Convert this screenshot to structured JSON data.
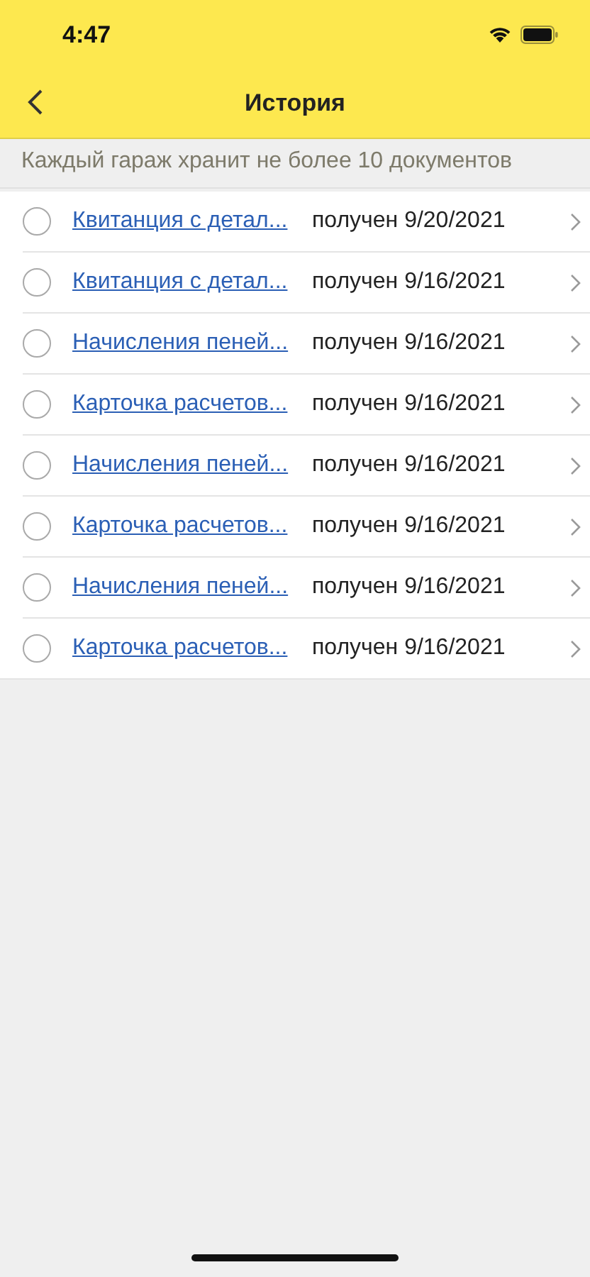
{
  "status_bar": {
    "time": "4:47"
  },
  "nav_bar": {
    "title": "История"
  },
  "notice": "Каждый гараж хранит не более 10 документов",
  "documents": [
    {
      "title": "Квитанция с детал...",
      "received": "получен 9/20/2021",
      "selected": false
    },
    {
      "title": "Квитанция с детал...",
      "received": "получен 9/16/2021",
      "selected": false
    },
    {
      "title": "Начисления пеней...",
      "received": "получен 9/16/2021",
      "selected": false
    },
    {
      "title": "Карточка расчетов...",
      "received": "получен 9/16/2021",
      "selected": false
    },
    {
      "title": "Начисления пеней...",
      "received": "получен 9/16/2021",
      "selected": false
    },
    {
      "title": "Карточка расчетов...",
      "received": "получен 9/16/2021",
      "selected": false
    },
    {
      "title": "Начисления пеней...",
      "received": "получен 9/16/2021",
      "selected": false
    },
    {
      "title": "Карточка расчетов...",
      "received": "получен 9/16/2021",
      "selected": false
    }
  ]
}
